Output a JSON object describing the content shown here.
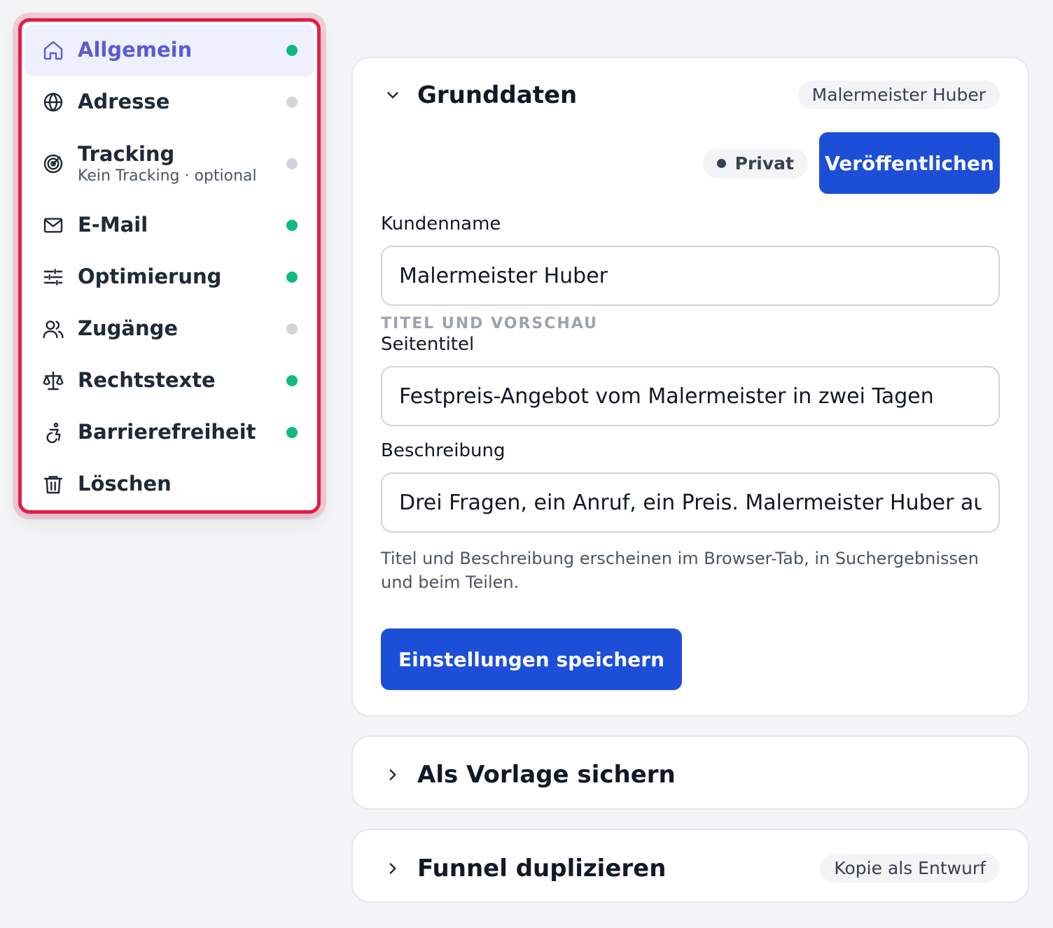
{
  "sidebar": {
    "items": [
      {
        "label": "Allgemein",
        "icon": "home-icon",
        "status": "green",
        "active": true
      },
      {
        "label": "Adresse",
        "icon": "globe-icon",
        "status": "gray"
      },
      {
        "label": "Tracking",
        "sublabel": "Kein Tracking · optional",
        "icon": "radar-icon",
        "status": "gray"
      },
      {
        "label": "E-Mail",
        "icon": "mail-icon",
        "status": "green"
      },
      {
        "label": "Optimierung",
        "icon": "sliders-icon",
        "status": "green"
      },
      {
        "label": "Zugänge",
        "icon": "users-icon",
        "status": "gray"
      },
      {
        "label": "Rechtstexte",
        "icon": "scale-icon",
        "status": "green"
      },
      {
        "label": "Barrierefreiheit",
        "icon": "accessibility-icon",
        "status": "green"
      },
      {
        "label": "Löschen",
        "icon": "trash-icon"
      }
    ]
  },
  "main": {
    "title": "Grunddaten",
    "badge": "Malermeister Huber",
    "visibility": "Privat",
    "publish_label": "Veröffentlichen",
    "customer_label": "Kundenname",
    "customer_value": "Malermeister Huber",
    "section_label": "TITEL UND VORSCHAU",
    "page_title_label": "Seitentitel",
    "page_title_value": "Festpreis-Angebot vom Malermeister in zwei Tagen",
    "description_label": "Beschreibung",
    "description_value": "Drei Fragen, ein Anruf, ein Preis. Malermeister Huber aus L",
    "help_text": "Titel und Beschreibung erscheinen im Browser-Tab, in Suchergebnissen und beim Teilen.",
    "save_label": "Einstellungen speichern"
  },
  "vorlage": {
    "title": "Als Vorlage sichern"
  },
  "duplicate": {
    "title": "Funnel duplizieren",
    "badge": "Kopie als Entwurf"
  },
  "colors": {
    "accent": "#1d4ed8",
    "active_nav": "#5b5bd6",
    "highlight_border": "#e11d48",
    "status_green": "#10b981",
    "status_gray": "#d1d5db"
  }
}
